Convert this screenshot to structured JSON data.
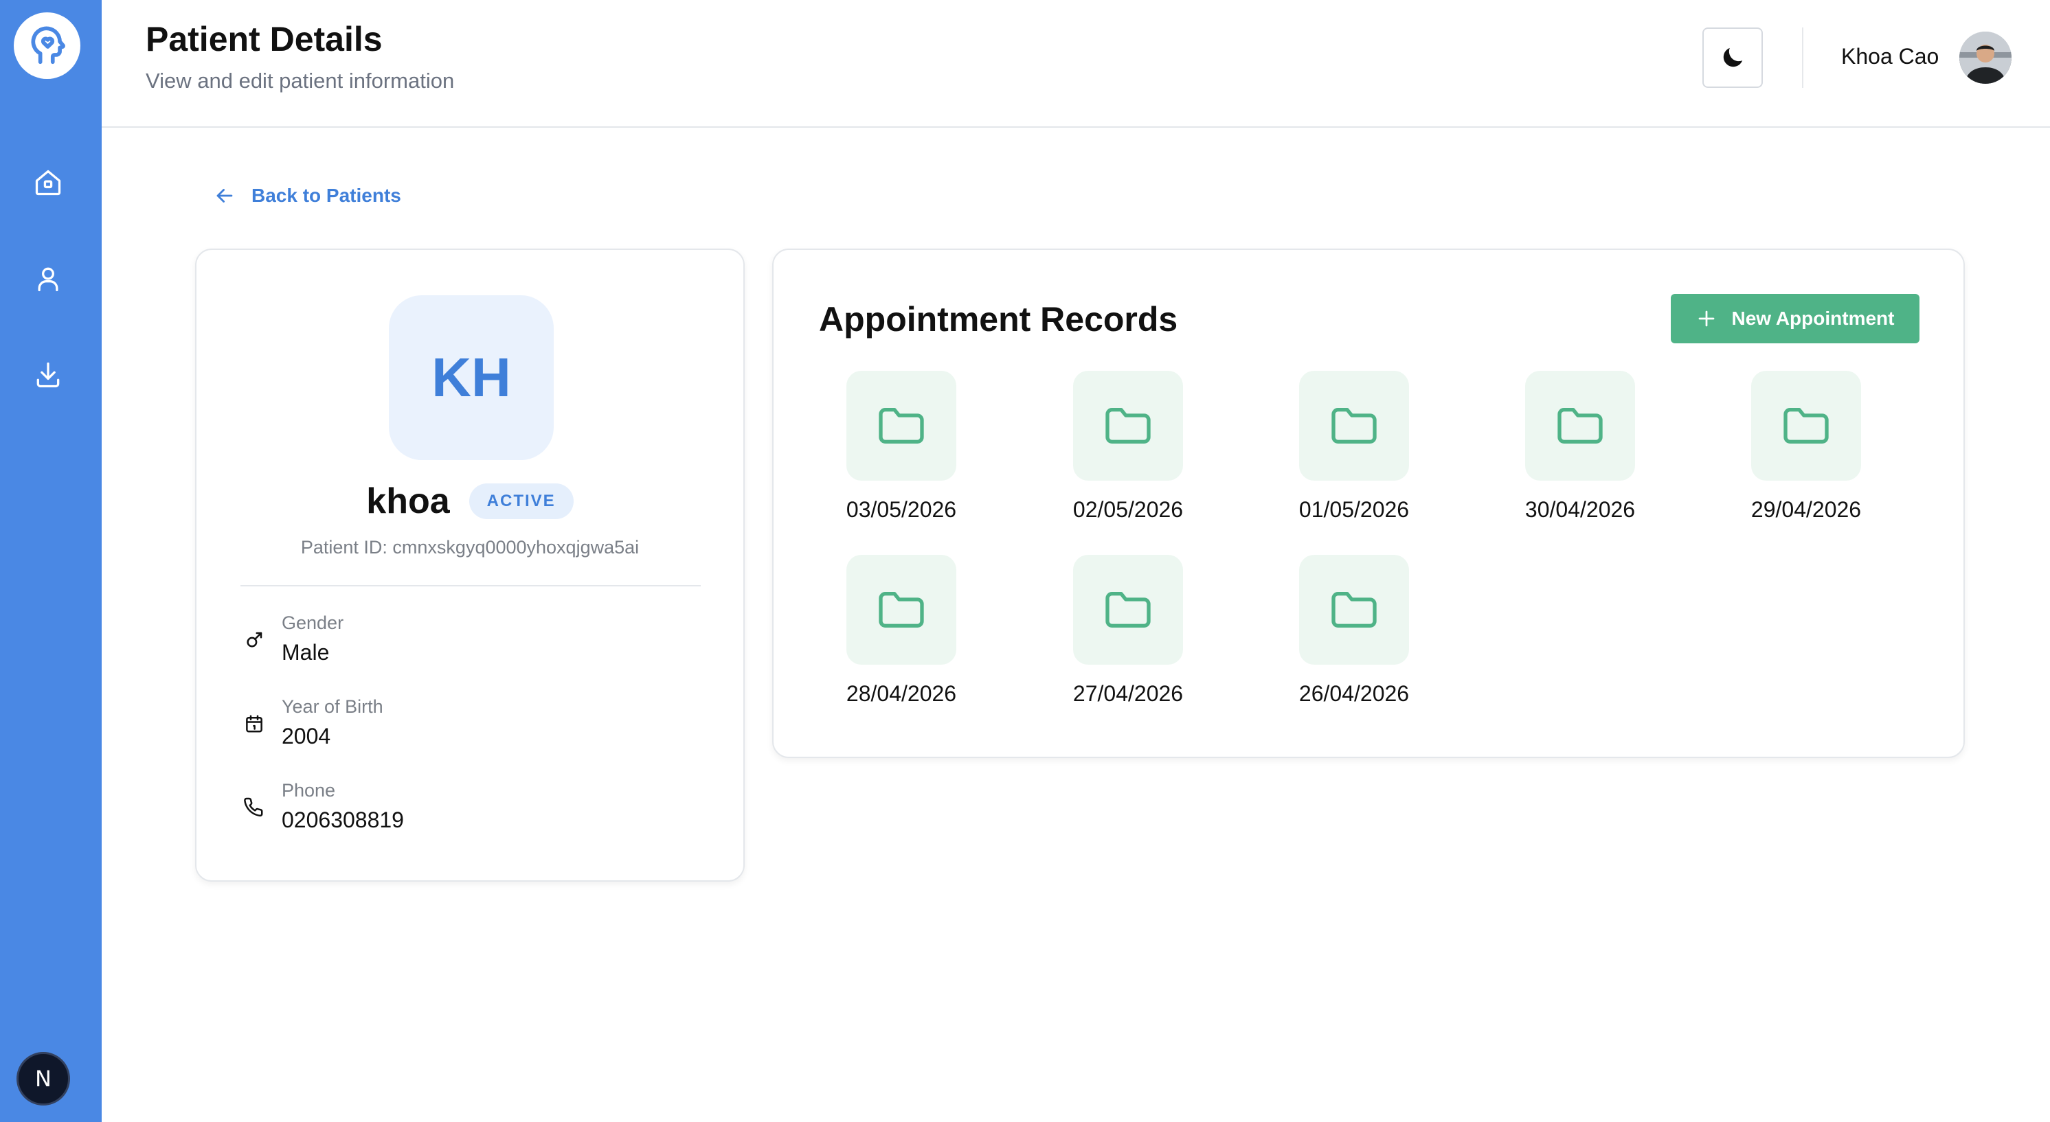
{
  "header": {
    "title": "Patient Details",
    "subtitle": "View and edit patient information",
    "user_name": "Khoa Cao"
  },
  "sidebar": {
    "items": [
      {
        "icon": "home-icon"
      },
      {
        "icon": "user-icon"
      },
      {
        "icon": "download-icon"
      }
    ],
    "bottom_badge": "N"
  },
  "back_link": {
    "label": "Back to Patients"
  },
  "patient": {
    "initials": "KH",
    "name": "khoa",
    "status": "ACTIVE",
    "id_text": "Patient ID: cmnxskgyq0000yhoxqjgwa5ai",
    "fields": {
      "gender": {
        "label": "Gender",
        "value": "Male"
      },
      "year_of_birth": {
        "label": "Year of Birth",
        "value": "2004"
      },
      "phone": {
        "label": "Phone",
        "value": "0206308819"
      }
    }
  },
  "appointments": {
    "title": "Appointment Records",
    "new_button_label": "New Appointment",
    "records": [
      {
        "date": "03/05/2026"
      },
      {
        "date": "02/05/2026"
      },
      {
        "date": "01/05/2026"
      },
      {
        "date": "30/04/2026"
      },
      {
        "date": "29/04/2026"
      },
      {
        "date": "28/04/2026"
      },
      {
        "date": "27/04/2026"
      },
      {
        "date": "26/04/2026"
      }
    ]
  },
  "colors": {
    "sidebar": "#4a88e4",
    "accent_blue": "#3f7fd9",
    "accent_green": "#4fb387",
    "folder_tile": "#edf7f1"
  }
}
